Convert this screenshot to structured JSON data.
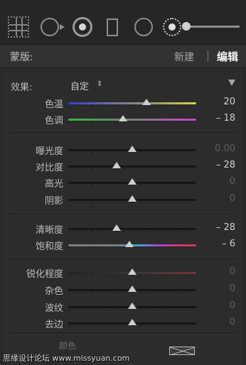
{
  "toolbar": {
    "tools": [
      {
        "icon": "crop-overlay-icon"
      },
      {
        "icon": "spot-removal-icon"
      },
      {
        "icon": "red-eye-icon"
      },
      {
        "icon": "graduated-filter-icon"
      },
      {
        "icon": "radial-filter-icon"
      },
      {
        "icon": "adjustment-brush-icon"
      }
    ],
    "brush_size_slider": {
      "level": 0.0
    }
  },
  "mask": {
    "label": "蒙版:",
    "new_label": "新建",
    "edit_label": "编辑"
  },
  "effect": {
    "label": "效果:",
    "value": "自定",
    "arrows": "⇕"
  },
  "sliders": [
    {
      "id": "temp",
      "label": "色温",
      "value": "20",
      "pos": 0.61,
      "track": "temp"
    },
    {
      "id": "tint",
      "label": "色调",
      "value": "– 18",
      "pos": 0.43,
      "track": "tint"
    },
    {
      "id": "exposure",
      "label": "曝光度",
      "value": "0.00",
      "pos": 0.5,
      "dim": true
    },
    {
      "id": "contrast",
      "label": "对比度",
      "value": "– 28",
      "pos": 0.38
    },
    {
      "id": "highlights",
      "label": "高光",
      "value": "0",
      "pos": 0.5,
      "dim": true
    },
    {
      "id": "shadows",
      "label": "阴影",
      "value": "0",
      "pos": 0.5,
      "dim": true
    },
    {
      "id": "clarity",
      "label": "清晰度",
      "value": "– 28",
      "pos": 0.38
    },
    {
      "id": "saturation",
      "label": "饱和度",
      "value": "– 6",
      "pos": 0.48,
      "track": "sat"
    },
    {
      "id": "sharpness",
      "label": "锐化程度",
      "value": "0",
      "pos": 0.5,
      "dim": true,
      "track": "sharp"
    },
    {
      "id": "noise",
      "label": "杂色",
      "value": "0",
      "pos": 0.5,
      "dim": true
    },
    {
      "id": "moire",
      "label": "波纹",
      "value": "0",
      "pos": 0.5,
      "dim": true
    },
    {
      "id": "defringe",
      "label": "去边",
      "value": "0",
      "pos": 0.5,
      "dim": true
    }
  ],
  "bottom": {
    "color_label": "颜色"
  },
  "watermark": "思缘设计论坛 www.missyuan.com",
  "colors": {
    "panel_bg": "#2c2c2c",
    "toolbar_bg": "#262626",
    "text": "#bdbdbd",
    "active_text": "#f2f2f2"
  }
}
